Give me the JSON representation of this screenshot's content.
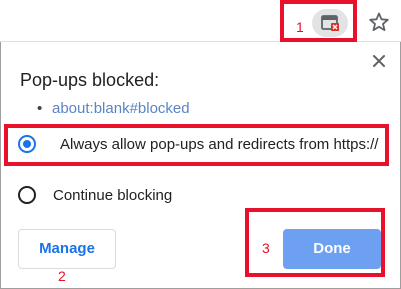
{
  "popup_bubble": {
    "title": "Pop-ups blocked:",
    "blocked_items": [
      "about:blank#blocked"
    ],
    "options": [
      {
        "label": "Always allow pop-ups and redirects from https://",
        "selected": true
      },
      {
        "label": "Continue blocking",
        "selected": false
      }
    ],
    "manage_label": "Manage",
    "done_label": "Done"
  },
  "annotations": {
    "marker_1": "1",
    "marker_2": "2",
    "marker_3": "3",
    "color": "#e8102a"
  },
  "icons": {
    "toolbar": [
      "popup-blocked-icon",
      "bookmark-star-icon"
    ],
    "bubble": [
      "close-icon",
      "bullet-icon"
    ]
  },
  "colors": {
    "accent": "#1a73e8",
    "done_button": "#6ea0f2",
    "link": "#5b84c4"
  }
}
